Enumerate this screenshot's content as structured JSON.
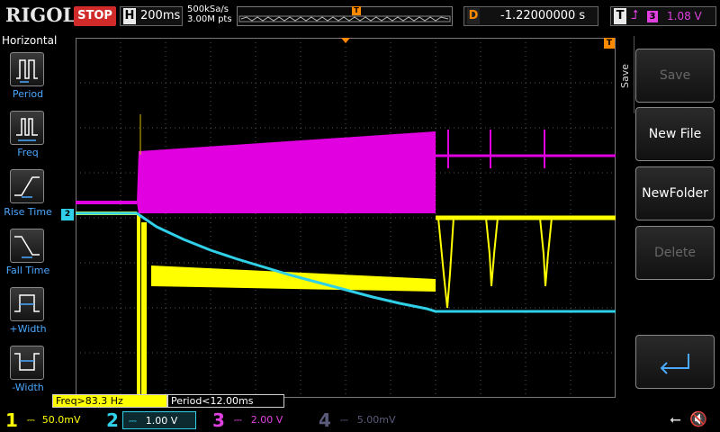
{
  "header": {
    "brand": "RIGOL",
    "run_state": "STOP",
    "timebase_label": "H",
    "timebase_value": "200ms",
    "sample_rate": "500kSa/s",
    "memory_depth": "3.00M pts",
    "delay_label": "D",
    "delay_value": "-1.22000000 s",
    "trigger_label": "T",
    "trigger_source": "3",
    "trigger_level": "1.08 V",
    "trigger_marker": "T"
  },
  "left_menu": {
    "title": "Horizontal",
    "items": [
      {
        "label": "Period",
        "icon": "period-icon"
      },
      {
        "label": "Freq",
        "icon": "frequency-icon"
      },
      {
        "label": "Rise Time",
        "icon": "rise-time-icon"
      },
      {
        "label": "Fall Time",
        "icon": "fall-time-icon"
      },
      {
        "label": "+Width",
        "icon": "positive-width-icon"
      },
      {
        "label": "-Width",
        "icon": "negative-width-icon"
      }
    ]
  },
  "right_menu": {
    "tab_label": "Save",
    "buttons": [
      {
        "label": "Save",
        "enabled": false
      },
      {
        "label": "New File",
        "enabled": true
      },
      {
        "label": "NewFolder",
        "enabled": true
      },
      {
        "label": "Delete",
        "enabled": false
      },
      {
        "label": "",
        "icon": "return-icon",
        "enabled": true
      }
    ]
  },
  "measurements": {
    "freq": "Freq>83.3 Hz",
    "period": "Period<12.00ms"
  },
  "channels": [
    {
      "num": "1",
      "scale": "50.0mV",
      "color": "#ffff00",
      "active": false
    },
    {
      "num": "2",
      "scale": "1.00 V",
      "color": "#2fd0e8",
      "active": true
    },
    {
      "num": "3",
      "scale": "2.00 V",
      "color": "#e040e0",
      "active": false
    },
    {
      "num": "4",
      "scale": "5.00mV",
      "color": "#5a5a7a",
      "active": false
    }
  ],
  "markers": {
    "ch2_ground": "2",
    "trigger_level_marker": "T",
    "trigger_pos_marker": "T"
  },
  "status_icons": [
    "usb-icon",
    "mute-icon"
  ],
  "colors": {
    "ch1": "#ffff00",
    "ch2": "#2fd0e8",
    "ch3": "#e040e0",
    "ch4": "#5a5a7a",
    "trigger": "#ff8a00",
    "stop": "#d12a2a",
    "menu_label": "#4aa8ff"
  }
}
